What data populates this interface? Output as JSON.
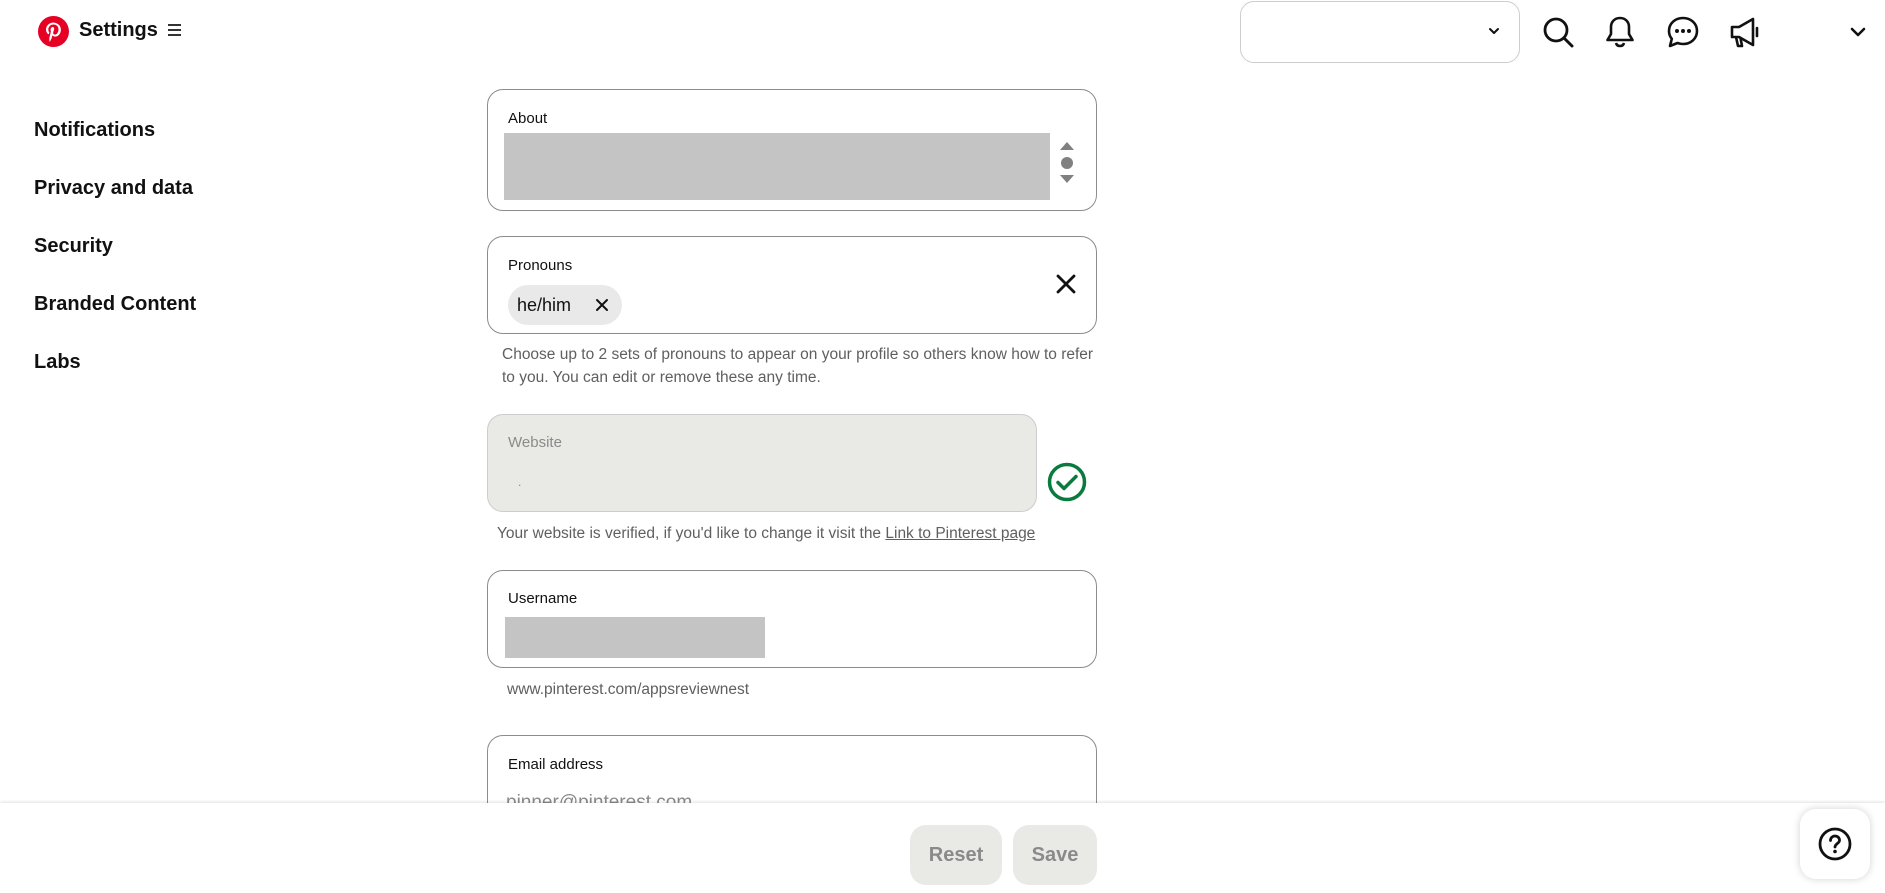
{
  "header": {
    "title": "Settings",
    "icons": [
      "pinterest-logo",
      "menu-icon",
      "chevron-down-icon",
      "search-icon",
      "bell-icon",
      "chat-icon",
      "megaphone-icon",
      "chevron-down-icon"
    ]
  },
  "sidebar": {
    "items": [
      {
        "label": "Notifications"
      },
      {
        "label": "Privacy and data"
      },
      {
        "label": "Security"
      },
      {
        "label": "Branded Content"
      },
      {
        "label": "Labs"
      }
    ]
  },
  "form": {
    "about": {
      "label": "About"
    },
    "pronouns": {
      "label": "Pronouns",
      "chips": [
        "he/him"
      ],
      "help": "Choose up to 2 sets of pronouns to appear on your profile so others know how to refer to you. You can edit or remove these any time."
    },
    "website": {
      "label": "Website",
      "value": ".",
      "help_prefix": "Your website is verified, if you'd like to change it visit the ",
      "help_link": "Link to Pinterest page"
    },
    "username": {
      "label": "Username",
      "help": "www.pinterest.com/appsreviewnest"
    },
    "email": {
      "label": "Email address",
      "placeholder": "pinner@pinterest.com"
    }
  },
  "footer": {
    "reset_label": "Reset",
    "save_label": "Save"
  },
  "colors": {
    "brand": "#e60023",
    "verified": "#0a7b3e",
    "disabled_bg": "#e9e9e5"
  }
}
